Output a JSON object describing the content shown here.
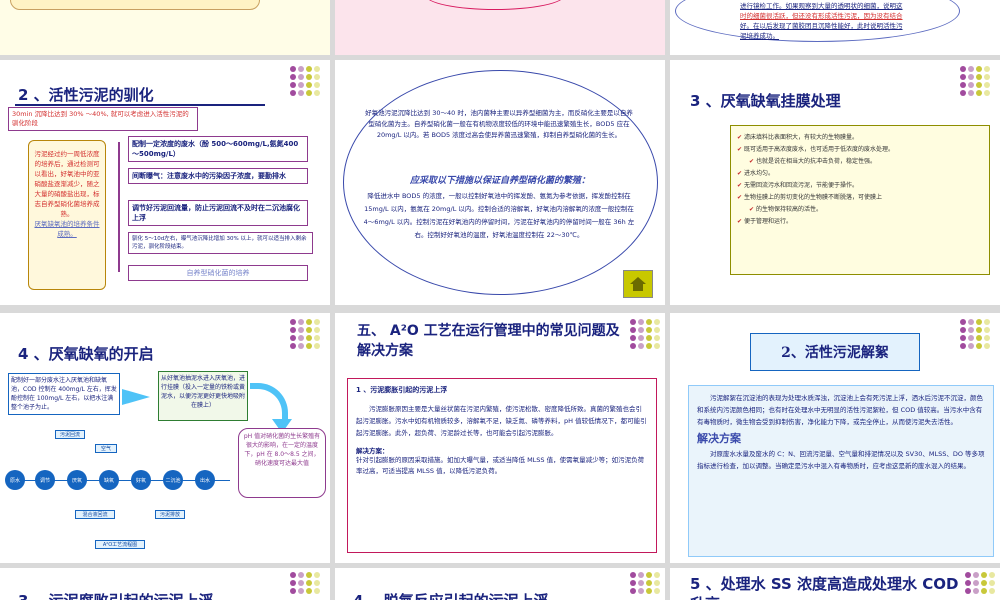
{
  "row0": {
    "col2_text": [
      "进行镜检工作。如果观察到大量的透明状的细菌，说明这",
      "时的细菌很活跃，但还没有形成活性污泥，因为没有结合",
      "好。在以后发现了菌胶团且沉降性能好，此时说明活性污",
      "泥培养成功。"
    ]
  },
  "slide1": {
    "title": "2 、活性污泥的驯化",
    "header_box": "30min 沉降比达到 30% ～40%, 就可以考虑进入活性污泥的驯化阶段",
    "scroll_text": "污泥经过约一周低浓度的培养后，通过检测可以看出，好氧池中的亚硝酸盐逐渐减少，随之大量的硝酸盐出现，标志自养型硝化菌培养成熟。",
    "scroll_link": "厌氧缺氧池的培养条件成熟。",
    "steps": [
      "配制一定浓度的废水（酚 500～600mg/L,氨氮400～500mg/L）",
      "间断曝气：注意废水中的污染因子浓度，要勤排水",
      "调节好污泥回流量，防止污泥回流不及时在二沉池腐化上浮",
      "驯化 5～10d左右，曝气池沉降比增加 30% 以上，就可以适当排入剩余污泥，驯化阶段结束。"
    ],
    "final_step": "自养型硝化菌的培养"
  },
  "slide2": {
    "p1": "好氧池污泥沉降比达到 30～40 时，池内菌种主要以异养型细菌为主，而反硝化主要是以自养型硝化菌为主。自养型硝化菌一般在有机物浓度较低的环境中能迅速繁殖生长，BOD5 应在 20mg/L 以内。若 BOD5 浓度过高会使异养菌迅速繁殖，抑制自养型硝化菌的生长。",
    "heading": "应采取以下措施以保证自养型硝化菌的繁殖：",
    "p2": "降低进水中 BOD5 的浓度，一般以控制好氧池中的挥发酚、氨氮为参考依据，挥发酚控制在 15mg/L 以内，氨氮在 20mg/L 以内。控制合适的溶解氧，好氧池内溶解氧的浓度一般控制在 4～6mg/L 以内。控制污泥在好氧池内的停留时间，污泥在好氧池内的停留时间一般在 36h 左右。控制好好氧池的温度，好氧池温度控制在 22～30℃。"
  },
  "slide3": {
    "title": "3 、厌氧缺氧挂膜处理",
    "items": [
      "滤床填料比表面积大，有较大的生物膜量。",
      "既可适用于高浓度废水，也可适用于低浓度的废水处理。",
      "也就是说在相当大的抗冲击负荷，稳定性强。",
      "进水均匀。",
      "无需回流污水和回流污泥，节能便于操作。",
      "生物挂膜上的剪切变化的生物膜不断脱落，可使膜上",
      "的生物保持较高的活性。",
      "便于管理和运行。"
    ]
  },
  "slide4": {
    "title": "4 、厌氧缺氧的开启",
    "box1": "配制好一部分废水注入厌氧池和缺氧池，COD 控制在 400mg/L 左右，挥发酚控制在 100mg/L 左右，以把水注满整个池子为止。",
    "box2": "从好氧池抽泥水进入厌氧池，进行挂膜（投入一定量的铁粉或黄泥水，以便污泥更好更快地吸附在膜上）",
    "ph_box": "pH 值对硝化菌的生长繁殖有很大的影响，在一定的温度下，pH 在 8.0～8.5 之间，硝化速度可达最大值",
    "flow_nodes": [
      "原水",
      "调节",
      "厌氧",
      "缺氧",
      "好氧",
      "二沉池",
      "出水"
    ],
    "flow_top": [
      "污泥回流",
      "空气"
    ],
    "flow_bottom": [
      "混合液回流",
      "污泥排放"
    ],
    "flow_caption": "A²O工艺流程图"
  },
  "slide5": {
    "title": "五、  A²O 工艺在运行管理中的常见问题及解决方案",
    "subtitle": "1 、污泥膨胀引起的污泥上浮",
    "p1": "污泥膨胀原因主要是大量丝状菌在污泥内繁殖，使污泥松散、密度降低所致。真菌的繁殖也会引起污泥膨胀。污水中如有机物质较多，溶解氧不足，缺乏氮、磷等养料，pH 值较低情况下，都可能引起污泥膨胀。此外，超负荷、污泥龄过长等，也可能会引起污泥膨胀。",
    "solution_label": "解决方案：",
    "solution": "针对引起膨胀的原因采取措施。如加大曝气量，或适当降低 MLSS 值，使需氧量减少等；如污泥负荷率过高，可适当提高 MLSS 值，以降低污泥负荷。"
  },
  "slide6": {
    "title": "2、活性污泥解絮",
    "p1": "污泥解絮在沉淀池的表现为处理水质浑浊，沉淀池上会有死污泥上浮，洒水后污泥不沉淀，颜色和系统内污泥颜色相同；也有时在处理水中无明显的活性污泥絮粒，但 COD 值较高。当污水中含有有毒物质时，微生物会受到抑制伤害，净化能力下降，或完全停止，从而使污泥失去活性。",
    "heading": "解决方案",
    "p2": "对原废水水量及废水的 C：N、回流污泥量、空气量和排泥情况以及 SV30、MLSS、DO 等多项指标进行检查，加以调整。当确定是污水中混入有毒物质时，应考虑这是新的废水混入的结果。"
  },
  "bottom": {
    "t1": "3 、污泥腐败引起的污泥上浮",
    "t2": "4 、脱氮反应引起的污泥上浮",
    "t3": "5 、处理水 SS 浓度高造成处理水 COD 升高"
  },
  "nav": {
    "home": "home-icon"
  },
  "colors": {
    "accent": "#1a237e",
    "purple": "#8e3a8e",
    "red": "#d32f2f"
  }
}
